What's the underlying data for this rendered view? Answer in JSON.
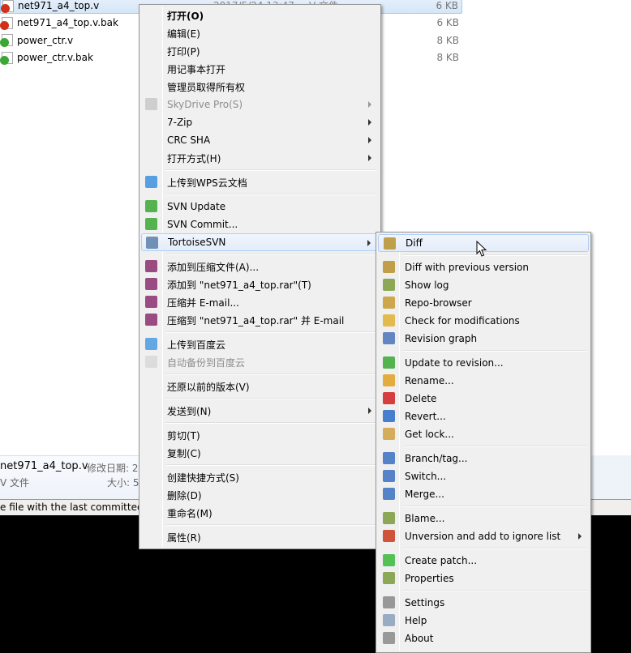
{
  "files": [
    {
      "name": "net971_a4_top.v",
      "date": "2017/5/24 13:47",
      "type": "V 文件",
      "size": "6 KB",
      "status": "conflict",
      "selected": true
    },
    {
      "name": "net971_a4_top.v.bak",
      "date": "",
      "type": "",
      "size": "6 KB",
      "status": "conflict",
      "selected": false
    },
    {
      "name": "power_ctr.v",
      "date": "",
      "type": "",
      "size": "8 KB",
      "status": "normal",
      "selected": false
    },
    {
      "name": "power_ctr.v.bak",
      "date": "",
      "type": "",
      "size": "8 KB",
      "status": "normal",
      "selected": false
    }
  ],
  "details": {
    "name": "net971_a4_top.v",
    "modified_label": "修改日期: 2",
    "type": "V 文件",
    "size_label": "大小: 5"
  },
  "status_text": "e file with the last committed",
  "main_menu": [
    {
      "label": "打开(O)",
      "bold": true
    },
    {
      "label": "编辑(E)"
    },
    {
      "label": "打印(P)"
    },
    {
      "label": "用记事本打开"
    },
    {
      "label": "管理员取得所有权"
    },
    {
      "label": "SkyDrive Pro(S)",
      "disabled": true,
      "submenu": true,
      "icon": "cloud-icon",
      "color": "#c8c8c8"
    },
    {
      "label": "7-Zip",
      "submenu": true
    },
    {
      "label": "CRC SHA",
      "submenu": true
    },
    {
      "label": "打开方式(H)",
      "submenu": true
    },
    {
      "sep": true
    },
    {
      "label": "上传到WPS云文档",
      "icon": "wps-cloud-icon",
      "color": "#3d8fe0"
    },
    {
      "sep": true
    },
    {
      "label": "SVN Update",
      "icon": "svn-update-icon",
      "color": "#3aa832"
    },
    {
      "label": "SVN Commit...",
      "icon": "svn-commit-icon",
      "color": "#3aa832"
    },
    {
      "label": "TortoiseSVN",
      "submenu": true,
      "highlight": true,
      "icon": "tortoisesvn-icon",
      "color": "#5a7fa8"
    },
    {
      "sep": true
    },
    {
      "label": "添加到压缩文件(A)...",
      "icon": "winrar-icon",
      "color": "#8a2e6e"
    },
    {
      "label": "添加到 \"net971_a4_top.rar\"(T)",
      "icon": "winrar-icon",
      "color": "#8a2e6e"
    },
    {
      "label": "压缩并 E-mail...",
      "icon": "winrar-icon",
      "color": "#8a2e6e"
    },
    {
      "label": "压缩到 \"net971_a4_top.rar\" 并 E-mail",
      "icon": "winrar-icon",
      "color": "#8a2e6e"
    },
    {
      "sep": true
    },
    {
      "label": "上传到百度云",
      "icon": "baidu-cloud-icon",
      "color": "#4a9be0"
    },
    {
      "label": "自动备份到百度云",
      "disabled": true,
      "icon": "baidu-backup-icon",
      "color": "#d8d8d8"
    },
    {
      "sep": true
    },
    {
      "label": "还原以前的版本(V)"
    },
    {
      "sep": true
    },
    {
      "label": "发送到(N)",
      "submenu": true
    },
    {
      "sep": true
    },
    {
      "label": "剪切(T)"
    },
    {
      "label": "复制(C)"
    },
    {
      "sep": true
    },
    {
      "label": "创建快捷方式(S)"
    },
    {
      "label": "删除(D)"
    },
    {
      "label": "重命名(M)"
    },
    {
      "sep": true
    },
    {
      "label": "属性(R)"
    }
  ],
  "tortoise_menu": [
    {
      "label": "Diff",
      "highlight": true,
      "icon": "diff-icon",
      "color": "#b8902a"
    },
    {
      "sep": true
    },
    {
      "label": "Diff with previous version",
      "icon": "diff-previous-icon",
      "color": "#b8902a"
    },
    {
      "label": "Show log",
      "icon": "show-log-icon",
      "color": "#7a9a3a"
    },
    {
      "label": "Repo-browser",
      "icon": "repo-browser-icon",
      "color": "#c89a30"
    },
    {
      "label": "Check for modifications",
      "icon": "check-modifications-icon",
      "color": "#e0b030"
    },
    {
      "label": "Revision graph",
      "icon": "revision-graph-icon",
      "color": "#4a72b8"
    },
    {
      "sep": true
    },
    {
      "label": "Update to revision...",
      "icon": "update-revision-icon",
      "color": "#3aa832"
    },
    {
      "label": "Rename...",
      "icon": "rename-icon",
      "color": "#e0a020"
    },
    {
      "label": "Delete",
      "icon": "delete-icon",
      "color": "#d02020"
    },
    {
      "label": "Revert...",
      "icon": "revert-icon",
      "color": "#2a6ac8"
    },
    {
      "label": "Get lock...",
      "icon": "lock-icon",
      "color": "#d0a040"
    },
    {
      "sep": true
    },
    {
      "label": "Branch/tag...",
      "icon": "branch-icon",
      "color": "#3a70c0"
    },
    {
      "label": "Switch...",
      "icon": "switch-icon",
      "color": "#3a70c0"
    },
    {
      "label": "Merge...",
      "icon": "merge-icon",
      "color": "#3a70c0"
    },
    {
      "sep": true
    },
    {
      "label": "Blame...",
      "icon": "blame-icon",
      "color": "#7a9a3a"
    },
    {
      "label": "Unversion and add to ignore list",
      "submenu": true,
      "icon": "ignore-icon",
      "color": "#c83a1a"
    },
    {
      "sep": true
    },
    {
      "label": "Create patch...",
      "icon": "create-patch-icon",
      "color": "#3ab83a"
    },
    {
      "label": "Properties",
      "icon": "properties-icon",
      "color": "#7a9a3a"
    },
    {
      "sep": true
    },
    {
      "label": "Settings",
      "icon": "settings-icon",
      "color": "#888888"
    },
    {
      "label": "Help",
      "icon": "help-icon",
      "color": "#8aa0b8"
    },
    {
      "label": "About",
      "icon": "about-icon",
      "color": "#8a8a8a"
    }
  ],
  "colors": {
    "conflict": "#d0301a",
    "normal": "#3aa832",
    "highlight": "#aecff7"
  }
}
